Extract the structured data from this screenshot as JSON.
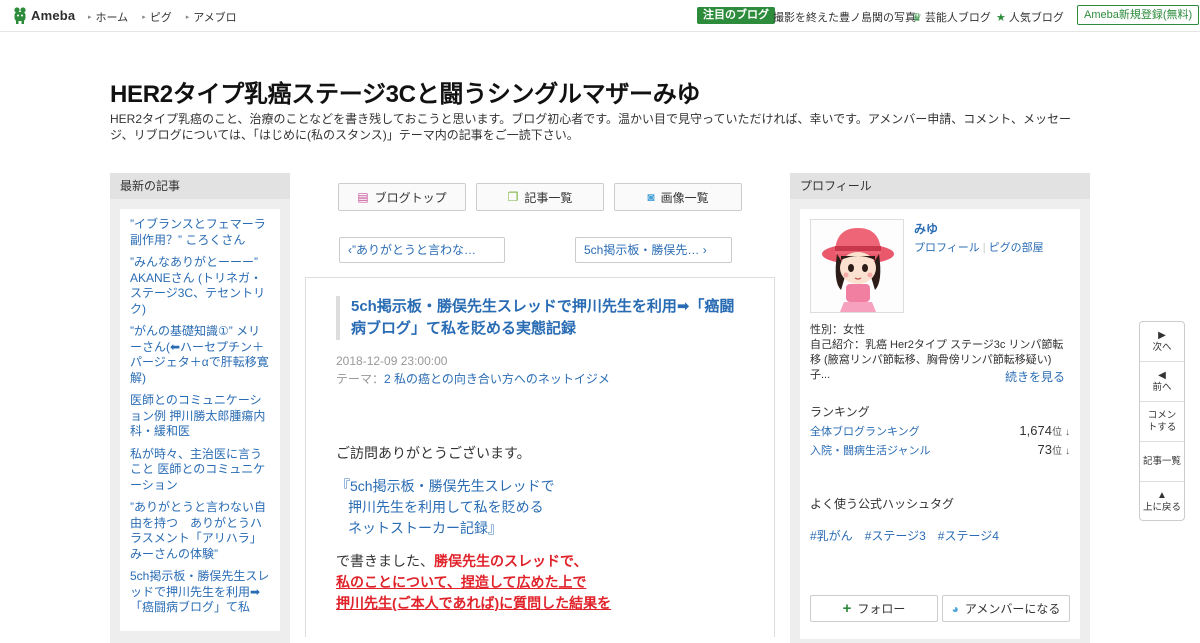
{
  "header": {
    "logo_text": "Ameba",
    "nav": [
      "ホーム",
      "ピグ",
      "アメブロ"
    ],
    "featured_badge": "注目のブログ",
    "featured_text": "撮影を終えた豊ノ島関の写真",
    "celeb_blog": "芸能人ブログ",
    "popular_blog": "人気ブログ",
    "signup": "Ameba新規登録(無料)"
  },
  "blog": {
    "title": "HER2タイプ乳癌ステージ3Cと闘うシングルマザーみゆ",
    "description": "HER2タイプ乳癌のこと、治療のことなどを書き残しておこうと思います。ブログ初心者です。温かい目で見守っていただければ、幸いです。アメンバー申請、コメント、メッセージ、リブログについては、「はじめに(私のスタンス)」テーマ内の記事をご一読下さい。"
  },
  "left_sidebar": {
    "heading": "最新の記事",
    "items": [
      "”イブランスとフェマーラ副作用？” ころくさん",
      "”みんなありがとーーー” AKANEさん (トリネガ・ステージ3C、テセントリク)",
      "”がんの基礎知識①” メリーさん(⬅ハーセプチン＋パージェタ＋αで肝転移寛解)",
      "医師とのコミュニケーション例 押川勝太郎腫瘍内科・緩和医",
      "私が時々、主治医に言うこと 医師とのコミュニケーション",
      "”ありがとうと言わない自由を持つ　ありがとうハラスメント「アリハラ」　みーさんの体験”",
      "5ch掲示板・勝俣先生スレッドで押川先生を利用➡「癌闘病ブログ」て私"
    ]
  },
  "tabs": {
    "blog_top": "ブログトップ",
    "articles": "記事一覧",
    "images": "画像一覧"
  },
  "pager": {
    "prev": "”ありがとうと言わな…",
    "next": "5ch掲示板・勝俣先…"
  },
  "entry": {
    "title": "5ch掲示板・勝俣先生スレッドで押川先生を利用➡「癌闘病ブログ」て私を貶める実態記録",
    "date": "2018-12-09 23:00:00",
    "theme_label": "テーマ：",
    "theme": "2 私の癌との向き合い方へのネットイジメ",
    "greeting": "ご訪問ありがとうございます。",
    "quote_1": "『5ch掲示板・勝俣先生スレッドで",
    "quote_2": "押川先生を利用して私を貶める",
    "quote_3": "ネットストーカー記録』",
    "body_1": "で書きました、",
    "body_red_1": "勝俣先生のスレッドで、",
    "body_red_2": "私のことについて、捏造して広めた上で",
    "body_red_3": "押川先生(ご本人であれば)に質問した結果を"
  },
  "profile": {
    "heading": "プロフィール",
    "name": "みゆ",
    "link_profile": "プロフィール",
    "link_pigu": "ピグの部屋",
    "gender": "性別：女性",
    "intro": "自己紹介：乳癌 Her2タイプ ステージ3c リンパ節転移 (腋窩リンパ節転移、胸骨傍リンパ節転移疑い) 子...",
    "read_more": "続きを見る",
    "ranking_heading": "ランキング",
    "ranking": [
      {
        "label": "全体ブログランキング",
        "value": "1,674",
        "unit": "位",
        "arrow": "↓"
      },
      {
        "label": "入院・闘病生活ジャンル",
        "value": "73",
        "unit": "位",
        "arrow": "↓"
      }
    ],
    "hashtag_heading": "よく使う公式ハッシュタグ",
    "hashtags": [
      "#乳がん",
      "#ステージ3",
      "#ステージ4"
    ],
    "follow": "フォロー",
    "amember": "アメンバーになる"
  },
  "float_nav": {
    "next": "次へ",
    "prev": "前へ",
    "comment": "コメントする",
    "articles": "記事一覧",
    "top": "上に戻る"
  },
  "colors": {
    "link": "#2a6cb4",
    "brand_green": "#2d8c3c",
    "highlight_red": "#e0222a"
  }
}
